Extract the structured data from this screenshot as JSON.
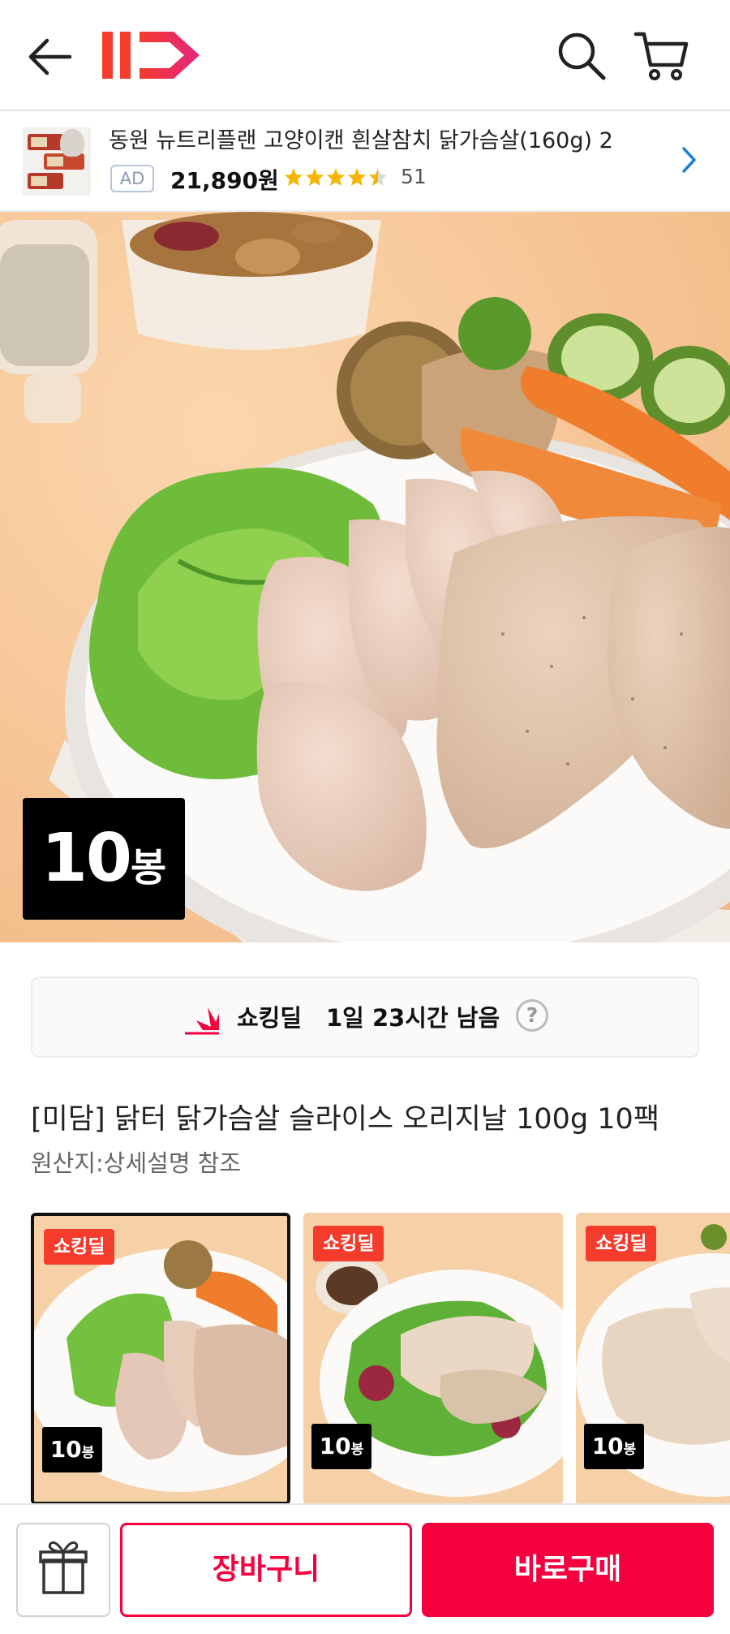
{
  "header": {
    "logo_text": "11",
    "back_icon": "arrow-left-icon",
    "search_icon": "search-icon",
    "cart_icon": "shopping-cart-icon",
    "brand_color": "#f43b2c"
  },
  "ad": {
    "title": "동원 뉴트리플랜 고양이캔 흰살참치 닭가슴살(160g) 2",
    "badge": "AD",
    "price": "21,890원",
    "rating": 4.5,
    "review_count": "51",
    "chevron_icon": "chevron-right-icon"
  },
  "hero": {
    "badge_number": "10",
    "badge_suffix": "봉"
  },
  "deal": {
    "label": "쇼킹딜",
    "remaining": "1일 23시간 남음",
    "help": "?"
  },
  "product": {
    "title": "[미담] 닭터 닭가슴살 슬라이스 오리지날 100g 10팩",
    "origin": "원산지:상세설명 참조"
  },
  "options": [
    {
      "badge": "쇼킹딜",
      "count": "10",
      "count_suffix": "봉",
      "selected": true
    },
    {
      "badge": "쇼킹딜",
      "count": "10",
      "count_suffix": "봉",
      "selected": false
    },
    {
      "badge": "쇼킹딜",
      "count": "10",
      "count_suffix": "봉",
      "selected": false
    }
  ],
  "bottom": {
    "gift_icon": "gift-icon",
    "cart_label": "장바구니",
    "buy_label": "바로구매",
    "accent": "#f4003e"
  }
}
